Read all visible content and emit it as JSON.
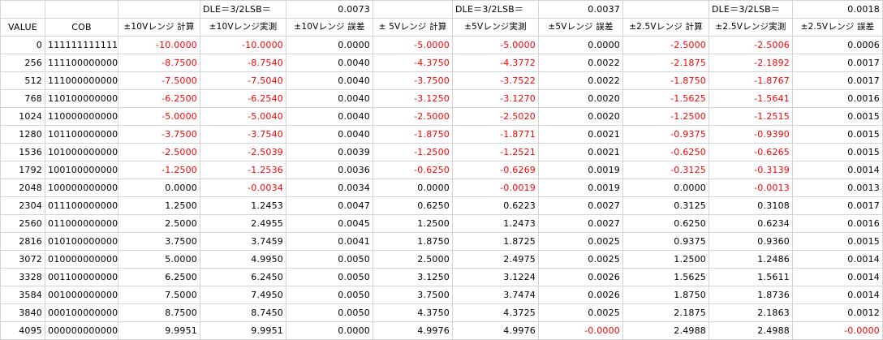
{
  "colors": {
    "negative": "#ff0000",
    "grid": "#d4d4d4",
    "text": "#000000"
  },
  "header1": {
    "dle_label_10": "DLE＝3/2LSB＝",
    "dle_value_10": "0.0073",
    "dle_label_5": "DLE＝3/2LSB＝",
    "dle_value_5": "0.0037",
    "dle_label_25": "DLE＝3/2LSB＝",
    "dle_value_25": "0.0018"
  },
  "header2": [
    "VALUE",
    "COB",
    "±10Vレンジ 計算",
    "±10Vレンジ実測",
    "±10Vレンジ 誤差",
    "± 5Vレンジ 計算",
    "±5Vレンジ実測",
    "±5Vレンジ 誤差",
    "±2.5Vレンジ 計算",
    "±2.5Vレンジ実測",
    "±2.5Vレンジ 誤差"
  ],
  "rows": [
    [
      "0",
      "111111111111",
      "-10.0000",
      "-10.0000",
      "0.0000",
      "-5.0000",
      "-5.0000",
      "0.0000",
      "-2.5000",
      "-2.5006",
      "0.0006"
    ],
    [
      "256",
      "111100000000",
      "-8.7500",
      "-8.7540",
      "0.0040",
      "-4.3750",
      "-4.3772",
      "0.0022",
      "-2.1875",
      "-2.1892",
      "0.0017"
    ],
    [
      "512",
      "111000000000",
      "-7.5000",
      "-7.5040",
      "0.0040",
      "-3.7500",
      "-3.7522",
      "0.0022",
      "-1.8750",
      "-1.8767",
      "0.0017"
    ],
    [
      "768",
      "110100000000",
      "-6.2500",
      "-6.2540",
      "0.0040",
      "-3.1250",
      "-3.1270",
      "0.0020",
      "-1.5625",
      "-1.5641",
      "0.0016"
    ],
    [
      "1024",
      "110000000000",
      "-5.0000",
      "-5.0040",
      "0.0040",
      "-2.5000",
      "-2.5020",
      "0.0020",
      "-1.2500",
      "-1.2515",
      "0.0015"
    ],
    [
      "1280",
      "101100000000",
      "-3.7500",
      "-3.7540",
      "0.0040",
      "-1.8750",
      "-1.8771",
      "0.0021",
      "-0.9375",
      "-0.9390",
      "0.0015"
    ],
    [
      "1536",
      "101000000000",
      "-2.5000",
      "-2.5039",
      "0.0039",
      "-1.2500",
      "-1.2521",
      "0.0021",
      "-0.6250",
      "-0.6265",
      "0.0015"
    ],
    [
      "1792",
      "100100000000",
      "-1.2500",
      "-1.2536",
      "0.0036",
      "-0.6250",
      "-0.6269",
      "0.0019",
      "-0.3125",
      "-0.3139",
      "0.0014"
    ],
    [
      "2048",
      "100000000000",
      "0.0000",
      "-0.0034",
      "0.0034",
      "0.0000",
      "-0.0019",
      "0.0019",
      "0.0000",
      "-0.0013",
      "0.0013"
    ],
    [
      "2304",
      "011100000000",
      "1.2500",
      "1.2453",
      "0.0047",
      "0.6250",
      "0.6223",
      "0.0027",
      "0.3125",
      "0.3108",
      "0.0017"
    ],
    [
      "2560",
      "011000000000",
      "2.5000",
      "2.4955",
      "0.0045",
      "1.2500",
      "1.2473",
      "0.0027",
      "0.6250",
      "0.6234",
      "0.0016"
    ],
    [
      "2816",
      "010100000000",
      "3.7500",
      "3.7459",
      "0.0041",
      "1.8750",
      "1.8725",
      "0.0025",
      "0.9375",
      "0.9360",
      "0.0015"
    ],
    [
      "3072",
      "010000000000",
      "5.0000",
      "4.9950",
      "0.0050",
      "2.5000",
      "2.4975",
      "0.0025",
      "1.2500",
      "1.2486",
      "0.0014"
    ],
    [
      "3328",
      "001100000000",
      "6.2500",
      "6.2450",
      "0.0050",
      "3.1250",
      "3.1224",
      "0.0026",
      "1.5625",
      "1.5611",
      "0.0014"
    ],
    [
      "3584",
      "001000000000",
      "7.5000",
      "7.4950",
      "0.0050",
      "3.7500",
      "3.7474",
      "0.0026",
      "1.8750",
      "1.8736",
      "0.0014"
    ],
    [
      "3840",
      "000100000000",
      "8.7500",
      "8.7450",
      "0.0050",
      "4.3750",
      "4.3725",
      "0.0025",
      "2.1875",
      "2.1863",
      "0.0012"
    ],
    [
      "4095",
      "000000000000",
      "9.9951",
      "9.9951",
      "0.0000",
      "4.9976",
      "4.9976",
      "-0.0000",
      "2.4988",
      "2.4988",
      "-0.0000"
    ]
  ]
}
